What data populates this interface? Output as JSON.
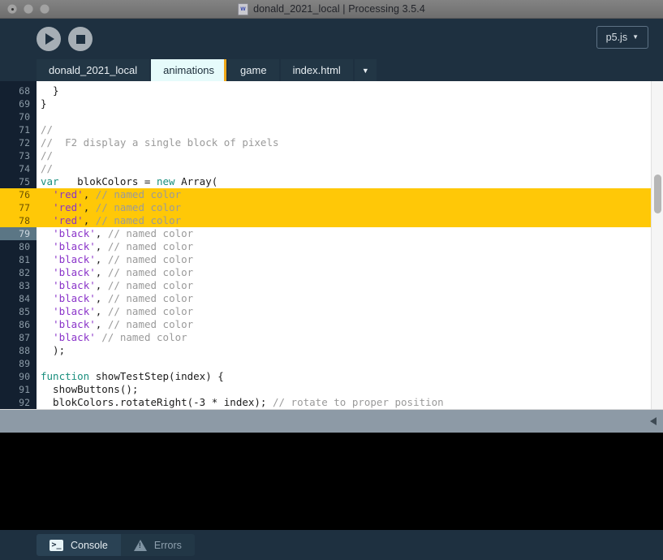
{
  "window": {
    "title": "donald_2021_local | Processing 3.5.4",
    "doc_icon_glyph": "w",
    "traffic_lights": [
      "close-button",
      "minimize-button",
      "zoom-button"
    ]
  },
  "toolbar": {
    "run_label": "Run",
    "stop_label": "Stop",
    "mode_label": "p5.js",
    "mode_caret": "▼"
  },
  "tabs": {
    "items": [
      {
        "label": "donald_2021_local",
        "active": false
      },
      {
        "label": "animations",
        "active": true
      },
      {
        "label": "game",
        "active": false
      },
      {
        "label": "index.html",
        "active": false
      }
    ],
    "overflow_label": "▼"
  },
  "editor": {
    "first_line_number": 68,
    "highlighted_lines": [
      76,
      77,
      78
    ],
    "current_line": 79,
    "lines": [
      {
        "n": 68,
        "tokens": [
          {
            "t": "  }",
            "c": "plain"
          }
        ]
      },
      {
        "n": 69,
        "tokens": [
          {
            "t": "}",
            "c": "plain"
          }
        ]
      },
      {
        "n": 70,
        "tokens": []
      },
      {
        "n": 71,
        "tokens": [
          {
            "t": "//",
            "c": "cmt"
          }
        ]
      },
      {
        "n": 72,
        "tokens": [
          {
            "t": "//  F2 display a single block of pixels",
            "c": "cmt"
          }
        ]
      },
      {
        "n": 73,
        "tokens": [
          {
            "t": "//",
            "c": "cmt"
          }
        ]
      },
      {
        "n": 74,
        "tokens": [
          {
            "t": "//",
            "c": "cmt"
          }
        ]
      },
      {
        "n": 75,
        "tokens": [
          {
            "t": "var",
            "c": "kw"
          },
          {
            "t": "   blokColors = ",
            "c": "plain"
          },
          {
            "t": "new",
            "c": "kw"
          },
          {
            "t": " Array(",
            "c": "plain"
          }
        ]
      },
      {
        "n": 76,
        "tokens": [
          {
            "t": "  ",
            "c": "plain"
          },
          {
            "t": "'red'",
            "c": "str"
          },
          {
            "t": ", ",
            "c": "plain"
          },
          {
            "t": "// named color",
            "c": "cmt"
          }
        ]
      },
      {
        "n": 77,
        "tokens": [
          {
            "t": "  ",
            "c": "plain"
          },
          {
            "t": "'red'",
            "c": "str"
          },
          {
            "t": ", ",
            "c": "plain"
          },
          {
            "t": "// named color",
            "c": "cmt"
          }
        ]
      },
      {
        "n": 78,
        "tokens": [
          {
            "t": "  ",
            "c": "plain"
          },
          {
            "t": "'red'",
            "c": "str"
          },
          {
            "t": ", ",
            "c": "plain"
          },
          {
            "t": "// named color",
            "c": "cmt"
          }
        ]
      },
      {
        "n": 79,
        "tokens": [
          {
            "t": "  ",
            "c": "plain"
          },
          {
            "t": "'black'",
            "c": "str"
          },
          {
            "t": ", ",
            "c": "plain"
          },
          {
            "t": "// named color",
            "c": "cmt"
          }
        ]
      },
      {
        "n": 80,
        "tokens": [
          {
            "t": "  ",
            "c": "plain"
          },
          {
            "t": "'black'",
            "c": "str"
          },
          {
            "t": ", ",
            "c": "plain"
          },
          {
            "t": "// named color",
            "c": "cmt"
          }
        ]
      },
      {
        "n": 81,
        "tokens": [
          {
            "t": "  ",
            "c": "plain"
          },
          {
            "t": "'black'",
            "c": "str"
          },
          {
            "t": ", ",
            "c": "plain"
          },
          {
            "t": "// named color",
            "c": "cmt"
          }
        ]
      },
      {
        "n": 82,
        "tokens": [
          {
            "t": "  ",
            "c": "plain"
          },
          {
            "t": "'black'",
            "c": "str"
          },
          {
            "t": ", ",
            "c": "plain"
          },
          {
            "t": "// named color",
            "c": "cmt"
          }
        ]
      },
      {
        "n": 83,
        "tokens": [
          {
            "t": "  ",
            "c": "plain"
          },
          {
            "t": "'black'",
            "c": "str"
          },
          {
            "t": ", ",
            "c": "plain"
          },
          {
            "t": "// named color",
            "c": "cmt"
          }
        ]
      },
      {
        "n": 84,
        "tokens": [
          {
            "t": "  ",
            "c": "plain"
          },
          {
            "t": "'black'",
            "c": "str"
          },
          {
            "t": ", ",
            "c": "plain"
          },
          {
            "t": "// named color",
            "c": "cmt"
          }
        ]
      },
      {
        "n": 85,
        "tokens": [
          {
            "t": "  ",
            "c": "plain"
          },
          {
            "t": "'black'",
            "c": "str"
          },
          {
            "t": ", ",
            "c": "plain"
          },
          {
            "t": "// named color",
            "c": "cmt"
          }
        ]
      },
      {
        "n": 86,
        "tokens": [
          {
            "t": "  ",
            "c": "plain"
          },
          {
            "t": "'black'",
            "c": "str"
          },
          {
            "t": ", ",
            "c": "plain"
          },
          {
            "t": "// named color",
            "c": "cmt"
          }
        ]
      },
      {
        "n": 87,
        "tokens": [
          {
            "t": "  ",
            "c": "plain"
          },
          {
            "t": "'black'",
            "c": "str"
          },
          {
            "t": " ",
            "c": "plain"
          },
          {
            "t": "// named color",
            "c": "cmt"
          }
        ]
      },
      {
        "n": 88,
        "tokens": [
          {
            "t": "  );",
            "c": "plain"
          }
        ]
      },
      {
        "n": 89,
        "tokens": []
      },
      {
        "n": 90,
        "tokens": [
          {
            "t": "function",
            "c": "kw"
          },
          {
            "t": " showTestStep(index) {",
            "c": "plain"
          }
        ]
      },
      {
        "n": 91,
        "tokens": [
          {
            "t": "  showButtons();",
            "c": "plain"
          }
        ]
      },
      {
        "n": 92,
        "tokens": [
          {
            "t": "  blokColors.rotateRight(-3 * index); ",
            "c": "plain"
          },
          {
            "t": "// rotate to proper position",
            "c": "cmt"
          }
        ]
      }
    ]
  },
  "console": {
    "output": ""
  },
  "statusbar": {
    "console_tab": "Console",
    "console_icon_glyph": ">_",
    "errors_tab": "Errors"
  },
  "colors": {
    "accent_highlight": "#ffc807",
    "active_tab_border": "#f0a818",
    "chrome_bg": "#1e3040",
    "gutter_bg": "#132030",
    "editor_bg": "#ffffff",
    "console_bg": "#000000",
    "divider_bg": "#8d9aa6",
    "keyword": "#1a8f7e",
    "string": "#8a33c9",
    "comment": "#9a9a9a"
  }
}
